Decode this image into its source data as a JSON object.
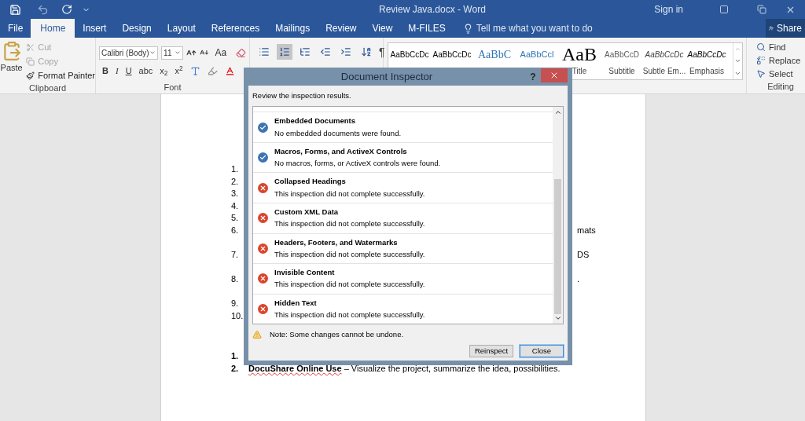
{
  "window": {
    "title": "Review Java.docx - Word",
    "sign_in": "Sign in"
  },
  "tabs": [
    {
      "label": "File",
      "selected": false
    },
    {
      "label": "Home",
      "selected": true
    },
    {
      "label": "Insert",
      "selected": false
    },
    {
      "label": "Design",
      "selected": false
    },
    {
      "label": "Layout",
      "selected": false
    },
    {
      "label": "References",
      "selected": false
    },
    {
      "label": "Mailings",
      "selected": false
    },
    {
      "label": "Review",
      "selected": false
    },
    {
      "label": "View",
      "selected": false
    },
    {
      "label": "M-FILES",
      "selected": false
    }
  ],
  "tell_me": {
    "placeholder": "Tell me what you want to do"
  },
  "share": "Share",
  "clipboard": {
    "paste": "Paste",
    "label": "Clipboard",
    "items": [
      {
        "kind": "cut",
        "label": "Cut",
        "disabled": true
      },
      {
        "kind": "copy",
        "label": "Copy",
        "disabled": true
      },
      {
        "kind": "painter",
        "label": "Format Painter",
        "disabled": false
      }
    ]
  },
  "font": {
    "name": "Calibri (Body)",
    "size": "11",
    "change_case": "Aa",
    "label": "Font",
    "format_buttons": [
      "B",
      "I",
      "U",
      "abc",
      "x$_{2}$",
      "x$^{2}$"
    ]
  },
  "paragraph": {
    "pilcrow": "¶",
    "buttons": [
      {
        "kind": "bullets",
        "selected": false
      },
      {
        "kind": "numbering",
        "selected": true
      },
      {
        "kind": "multilevel",
        "selected": false
      },
      {
        "kind": "outdent",
        "selected": false
      },
      {
        "kind": "indent",
        "selected": false
      },
      {
        "kind": "sort",
        "selected": false
      }
    ]
  },
  "styles": {
    "gallery": [
      {
        "kind": "normal",
        "preview": "AaBbCcDc"
      },
      {
        "kind": "normal",
        "preview": "AaBbCcDc"
      },
      {
        "kind": "heading1",
        "preview": "AaBbC"
      },
      {
        "kind": "heading2",
        "preview": "AaBbCcl"
      },
      {
        "kind": "title",
        "preview": "AaB",
        "name": "Title"
      },
      {
        "kind": "subtitle",
        "preview": "AaBbCcD",
        "name": "Subtitle"
      },
      {
        "kind": "subtle",
        "preview": "AaBbCcDc",
        "name": "Subtle Em..."
      },
      {
        "kind": "emphasis",
        "preview": "AaBbCcDc",
        "name": "Emphasis"
      }
    ]
  },
  "editing": {
    "label": "Editing",
    "items": [
      {
        "kind": "find",
        "label": "Find"
      },
      {
        "kind": "replace",
        "label": "Replace"
      },
      {
        "kind": "select",
        "label": "Select"
      }
    ]
  },
  "document": {
    "list": [
      {
        "number": "1."
      },
      {
        "number": "2."
      },
      {
        "number": "3."
      },
      {
        "number": "4."
      },
      {
        "number": "5."
      },
      {
        "number": "6.",
        "tail": "mats"
      },
      {
        "number": "7.",
        "tail": "DS"
      },
      {
        "number": "8.",
        "tail": "."
      },
      {
        "number": "9."
      },
      {
        "number": "10."
      }
    ],
    "list2": [
      {
        "number": "1."
      },
      {
        "number": "2.",
        "lead": "DocuShare Online Use",
        "text": " – Visualize the project, summarize the idea, possibilities."
      }
    ]
  },
  "dialog": {
    "title": "Document Inspector",
    "help": "?",
    "intro": "Review the inspection results.",
    "results": [
      {
        "kind": "passed",
        "title": "Embedded Documents",
        "detail": "No embedded documents were found."
      },
      {
        "kind": "passed",
        "title": "Macros, Forms, and ActiveX Controls",
        "detail": "No macros, forms, or ActiveX controls were found."
      },
      {
        "kind": "failed",
        "title": "Collapsed Headings",
        "detail": "This inspection did not complete successfully."
      },
      {
        "kind": "failed",
        "title": "Custom XML Data",
        "detail": "This inspection did not complete successfully."
      },
      {
        "kind": "failed",
        "title": "Headers, Footers, and Watermarks",
        "detail": "This inspection did not complete successfully."
      },
      {
        "kind": "failed",
        "title": "Invisible Content",
        "detail": "This inspection did not complete successfully."
      },
      {
        "kind": "failed",
        "title": "Hidden Text",
        "detail": "This inspection did not complete successfully."
      }
    ],
    "note": "Note: Some changes cannot be undone.",
    "buttons": [
      {
        "label": "Reinspect",
        "default": false
      },
      {
        "label": "Close",
        "default": true
      }
    ]
  }
}
